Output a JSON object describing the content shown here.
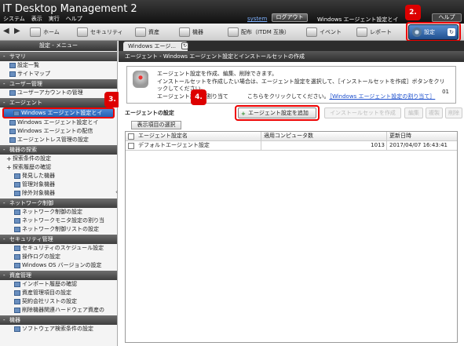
{
  "app": {
    "title": "IT Desktop Management 2",
    "menu": [
      "システム",
      "表示",
      "実行",
      "ヘルプ"
    ],
    "system_link": "system",
    "logout": "ログアウト",
    "page_name": "Windows エージェント設定とイ",
    "help": "ヘルプ"
  },
  "toolbar": {
    "items": [
      "ホーム",
      "セキュリティ",
      "資産",
      "機器",
      "配布（ITDM 互換）",
      "イベント",
      "レポート"
    ],
    "settings": "設定"
  },
  "badges": {
    "b1": "2.",
    "b2": "3.",
    "b3": "4."
  },
  "left": {
    "header": "設定 - メニュー",
    "sections": {
      "summary": "サマリ",
      "user": "ユーザー管理",
      "agent": "エージェント",
      "device": "機器の探索",
      "network": "ネットワーク制御",
      "security": "セキュリティ管理",
      "asset": "資産管理",
      "device2": "機器"
    },
    "summary_items": [
      "設定一覧",
      "サイトマップ"
    ],
    "user_items": [
      "ユーザーアカウントの管理"
    ],
    "agent_items": [
      "Windows エージェント設定とイ",
      "Windows エージェント設定とイ",
      "Windows エージェントの配信",
      "エージェントレス管理の設定"
    ],
    "device_items": [
      "探索条件の設定",
      "探索履歴の確認",
      "発見した機器",
      "管理対象機器",
      "除外対象機器"
    ],
    "network_items": [
      "ネットワーク制御の設定",
      "ネットワークモニタ設定の割り当",
      "ネットワーク制御リストの設定"
    ],
    "security_items": [
      "セキュリティのスケジュール設定",
      "操作ログの設定",
      "Windows OS バージョンの設定"
    ],
    "asset_items": [
      "インポート履歴の確認",
      "資産管理項目の設定",
      "契約会社リストの設定",
      "削除機器関連ハードウェア資産の"
    ],
    "device2_items": [
      "ソフトウェア検索条件の設定"
    ]
  },
  "tab": {
    "label": "Windows エージ...",
    "refresh": "↻"
  },
  "page": {
    "header": "エージェント - Windows エージェント設定とインストールセットの作成",
    "desc1": "エージェント設定を作成、編集、削除できます。",
    "desc2": "インストールセットを作成したい場合は、エージェント設定を選択して、［インストールセットを作成］ボタンをクリ",
    "desc3": "ックしてください。",
    "desc4_pre": "エージェント設定を割り当て",
    "desc4_mid": "こちらをクリックしてください。",
    "desc4_link": "［Windows エージェント設定の割り当て］",
    "count": "01",
    "agent_settings_label": "エージェントの設定",
    "add_button": "エージェント設定を追加",
    "create_set_button": "インストールセットを作成",
    "edit_button": "編集",
    "copy_button": "複製",
    "delete_button": "削除",
    "select_columns": "表示項目の選択"
  },
  "grid": {
    "headers": [
      "エージェント設定名",
      "適用コンピュータ数",
      "更新日時"
    ],
    "rows": [
      {
        "name": "デフォルトエージェント設定",
        "count": "1013",
        "updated": "2017/04/07 16:43:41"
      }
    ]
  }
}
